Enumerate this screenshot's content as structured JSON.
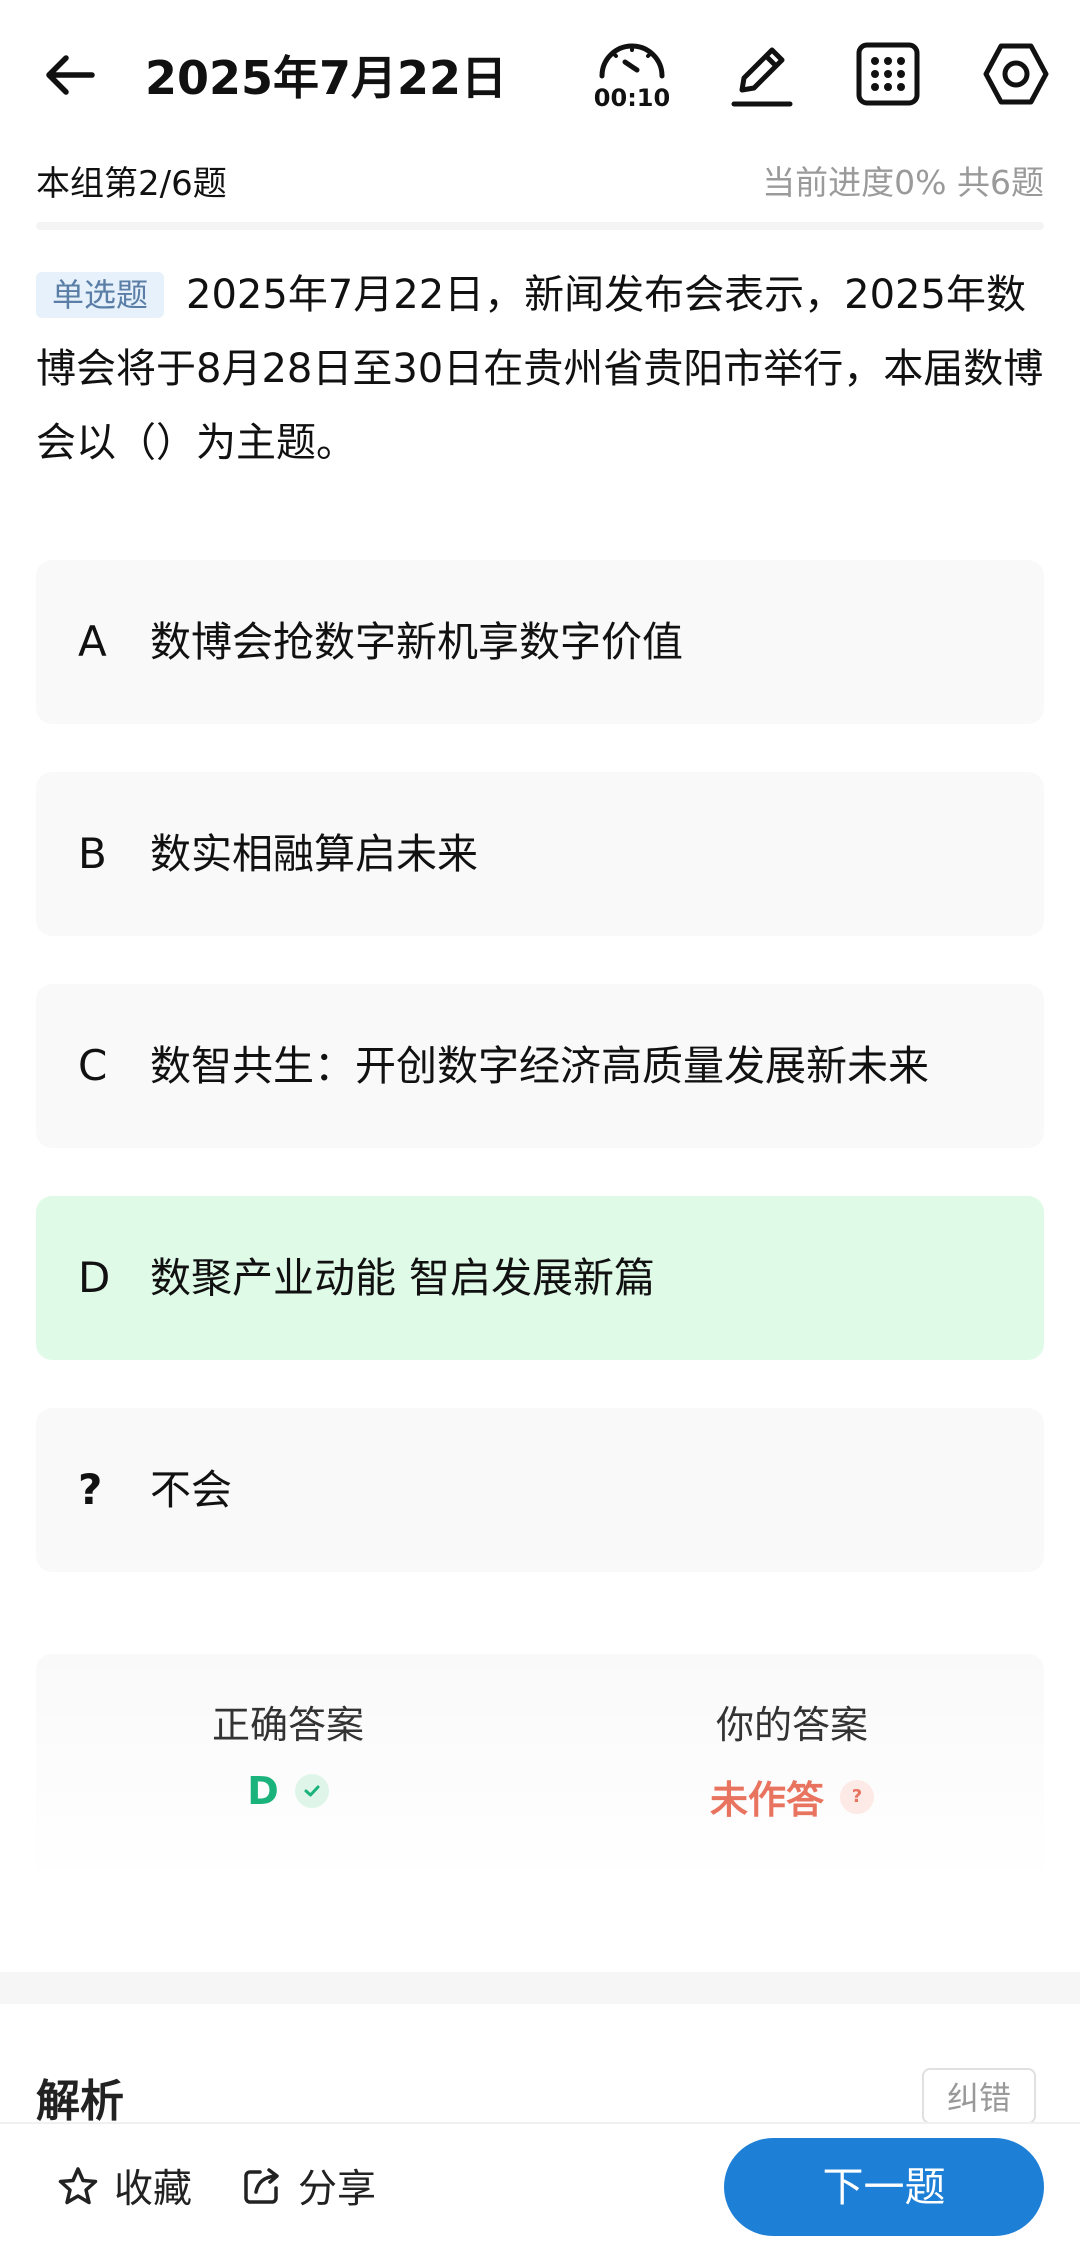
{
  "header": {
    "title": "2025年7月22日",
    "timer": "00:10"
  },
  "subbar": {
    "group": "本组第2/6题",
    "progress": "当前进度0%  共6题"
  },
  "question": {
    "type": "单选题",
    "text": "2025年7月22日，新闻发布会表示，2025年数博会将于8月28日至30日在贵州省贵阳市举行，本届数博会以（）为主题。"
  },
  "options": [
    {
      "letter": "A",
      "text": "数博会抢数字新机享数字价值"
    },
    {
      "letter": "B",
      "text": "数实相融算启未来"
    },
    {
      "letter": "C",
      "text": "数智共生：开创数字经济高质量发展新未来"
    },
    {
      "letter": "D",
      "text": "数聚产业动能 智启发展新篇"
    },
    {
      "letter": "?",
      "text": "不会"
    }
  ],
  "answers": {
    "correct_label": "正确答案",
    "correct_value": "D",
    "yours_label": "你的答案",
    "yours_value": "未作答",
    "yours_badge": "?"
  },
  "analysis": {
    "title": "解析",
    "report_label": "纠错"
  },
  "bottom": {
    "favorite_label": "收藏",
    "share_label": "分享",
    "next_label": "下一题"
  },
  "colors": {
    "accent": "#1e7fd6",
    "correct": "#1bb37c",
    "unanswered": "#e8735f",
    "correct_bg": "#e0fae8"
  },
  "icons": [
    "back-arrow-icon",
    "timer-icon",
    "pen-icon",
    "grid-icon",
    "settings-icon",
    "check-icon",
    "star-icon",
    "share-icon"
  ]
}
